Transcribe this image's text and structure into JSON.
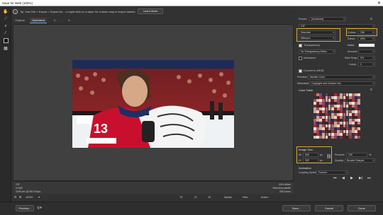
{
  "window": {
    "title": "Save for Web (100%)",
    "close": "✕"
  },
  "tip": {
    "text": "Tip: Use File > Export > Export As... or right click on a layer for a faster way to export assets.",
    "button": "Learn More"
  },
  "tabs": [
    "Original",
    "Optimized",
    "2-Up",
    "4-Up"
  ],
  "info": {
    "left": [
      "GIF",
      "6.00M",
      "1189 sec @ 56.6 Kbps"
    ],
    "right": [
      "99% dither",
      "Selective palette",
      "256 colors"
    ]
  },
  "zoom": {
    "value": "100%",
    "r": "R:",
    "g": "G:",
    "b": "B:",
    "alpha": "Alpha:",
    "hex": "Hex:",
    "index": "Index:"
  },
  "buttons": {
    "preview": "Preview...",
    "save": "Save...",
    "cancel": "Cancel",
    "done": "Done"
  },
  "settings": {
    "preset_label": "Preset:",
    "preset_value": "[Unnamed]",
    "format": "GIF",
    "reduction": "Selective",
    "dither_algo": "Diffusion",
    "colors_label": "Colors:",
    "colors_value": "256",
    "dither_label": "Dither:",
    "dither_value": "99%",
    "transparency_label": "Transparency",
    "matte_label": "Matte:",
    "trans_dither": "No Transparency Dither",
    "amount_label": "Amount:",
    "interlaced_label": "Interlaced",
    "web_snap_label": "Web Snap:",
    "web_snap_value": "0%",
    "lossy_label": "Lossy:",
    "lossy_value": "0",
    "convert_label": "Convert to sRGB",
    "preview_label": "Preview:",
    "preview_value": "Monitor Color",
    "metadata_label": "Metadata:",
    "metadata_value": "Copyright and Contact Info",
    "color_table_label": "Color Table",
    "image_size_label": "Image Size",
    "w_label": "W:",
    "w_value": "540",
    "h_label": "H:",
    "h_value": "292",
    "px": "px",
    "percent_label": "Percent:",
    "percent_value": "100",
    "pct": "%",
    "quality_label": "Quality:",
    "quality_value": "Bicubic Sharper",
    "animation_label": "Animation",
    "looping_label": "Looping Options:",
    "looping_value": "Forever"
  },
  "anim_controls": [
    "⏮",
    "◀",
    "▶",
    "▶|",
    "⏭"
  ],
  "colors": {
    "accent": "#d7a92c",
    "panel": "#333333",
    "canvas": "#404040"
  }
}
